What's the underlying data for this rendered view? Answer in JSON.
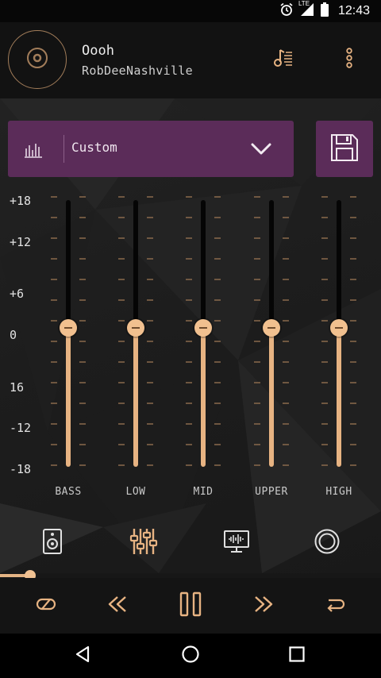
{
  "status_bar": {
    "time": "12:43",
    "network": "LTE"
  },
  "now_playing": {
    "title": "Oooh",
    "artist": "RobDeeNashville"
  },
  "preset": {
    "selected": "Custom"
  },
  "scale_labels": [
    "+18",
    "+12",
    "+6",
    "0",
    "16",
    "-12",
    "-18"
  ],
  "bands": [
    {
      "label": "BASS",
      "level_db": 0
    },
    {
      "label": "LOW",
      "level_db": 0
    },
    {
      "label": "MID",
      "level_db": 0
    },
    {
      "label": "UPPER",
      "level_db": 0
    },
    {
      "label": "HIGH",
      "level_db": 0
    }
  ],
  "level_range_db": [
    -18,
    18
  ],
  "playback_progress": 0.08,
  "colors": {
    "accent": "#e7b382",
    "panel": "#5b2c59",
    "background": "#1b1b1b"
  },
  "icons": {
    "header": [
      "disc-icon",
      "playlist-icon",
      "more-vert-icon"
    ],
    "nav": [
      "speaker-icon",
      "equalizer-icon",
      "visualizer-icon",
      "surround-icon"
    ],
    "controls": [
      "shuffle-icon",
      "rewind-icon",
      "pause-icon",
      "fast-forward-icon",
      "repeat-icon"
    ],
    "system": [
      "back-icon",
      "home-icon",
      "recents-icon"
    ]
  }
}
